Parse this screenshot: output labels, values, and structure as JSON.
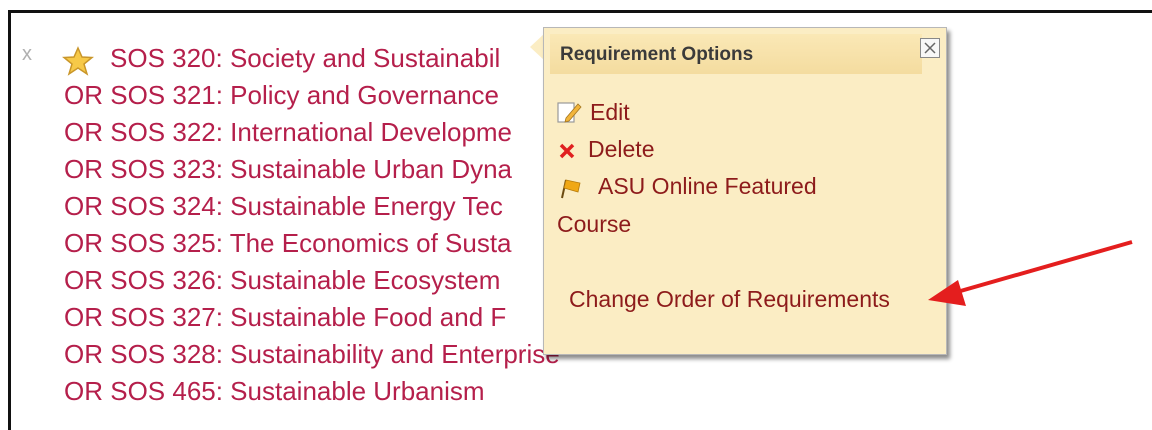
{
  "requirements": {
    "remove_glyph": "x",
    "items": [
      {
        "label": "SOS 320: Society and Sustainabil"
      },
      {
        "label": "OR SOS 321: Policy and Governance"
      },
      {
        "label": "OR SOS 322: International Developme"
      },
      {
        "label": "OR SOS 323: Sustainable Urban Dyna"
      },
      {
        "label": "OR SOS 324: Sustainable Energy Tec"
      },
      {
        "label": "OR SOS 325: The Economics of Susta"
      },
      {
        "label": "OR SOS 326: Sustainable Ecosystem"
      },
      {
        "label": "OR SOS 327: Sustainable Food and F"
      },
      {
        "label": "OR SOS 328: Sustainability and Enterprise"
      },
      {
        "label": "OR SOS 465: Sustainable Urbanism"
      }
    ]
  },
  "popup": {
    "title": "Requirement Options",
    "close_glyph": "×",
    "options": {
      "edit": "Edit",
      "delete": "Delete",
      "featured_line1": "ASU Online Featured",
      "featured_line2": "Course",
      "change_order": "Change Order of Requirements"
    }
  },
  "colors": {
    "link": "#b51f4b",
    "popup_bg": "#fbedc4",
    "option_text": "#8d1b1b",
    "arrow": "#e41e1e"
  },
  "icons": {
    "star": "star-icon",
    "edit": "edit-pencil-icon",
    "delete": "delete-x-icon",
    "featured": "flag-icon",
    "close": "close-icon",
    "annotation": "red-arrow-icon"
  }
}
